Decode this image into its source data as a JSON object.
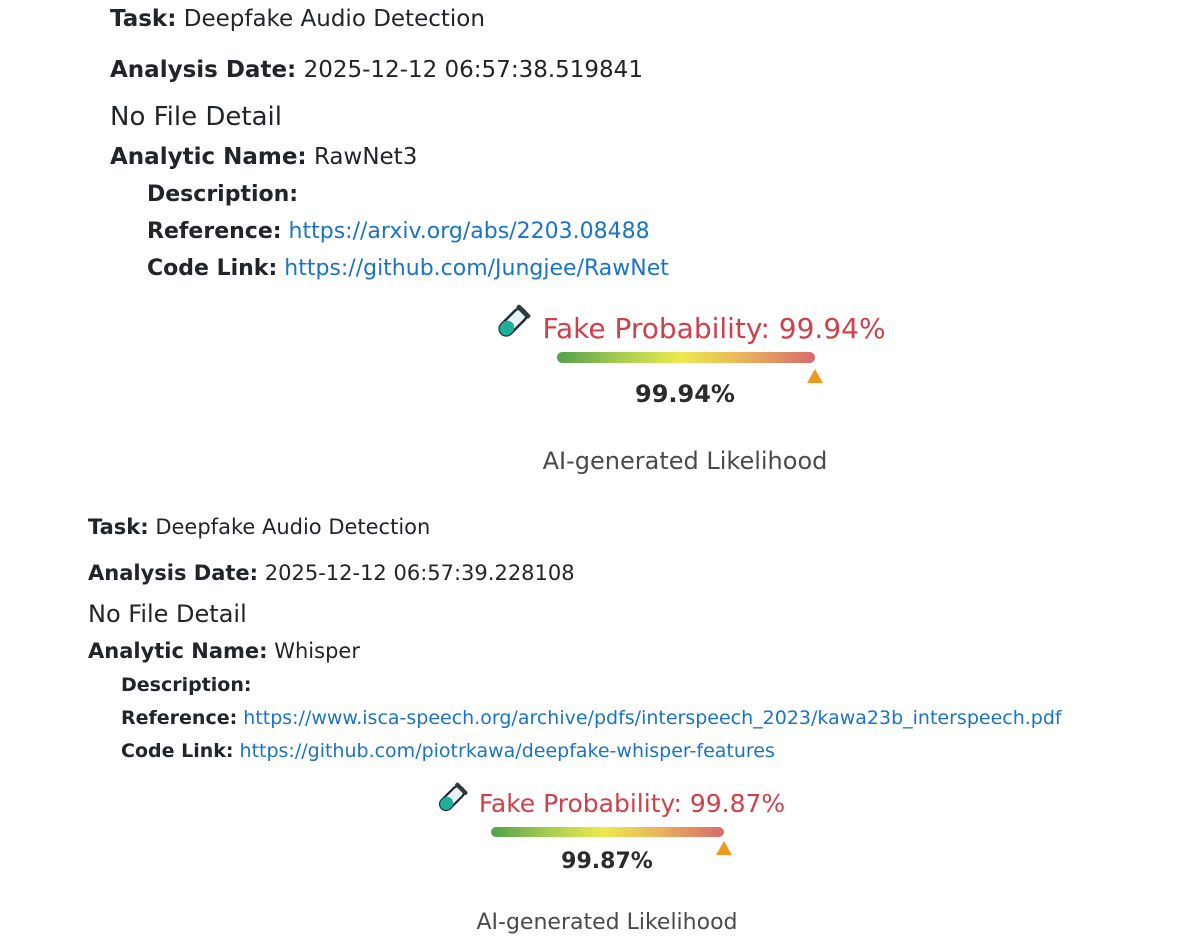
{
  "labels": {
    "task": "Task:",
    "analysis_date": "Analysis Date:",
    "analytic_name": "Analytic Name:",
    "description": "Description:",
    "reference": "Reference:",
    "code_link": "Code Link:"
  },
  "results": [
    {
      "task": "Deepfake Audio Detection",
      "analysis_date": "2025-12-12 06:57:38.519841",
      "file_detail": "No File Detail",
      "analytic_name": "RawNet3",
      "description": "",
      "reference": "https://arxiv.org/abs/2203.08488",
      "code_link": "https://github.com/Jungjee/RawNet",
      "fake_probability_text": "Fake Probability: 99.94%",
      "gauge_value_text": "99.94%",
      "gauge_value": 99.94,
      "likelihood_label": "AI-generated Likelihood"
    },
    {
      "task": "Deepfake Audio Detection",
      "analysis_date": "2025-12-12 06:57:39.228108",
      "file_detail": "No File Detail",
      "analytic_name": "Whisper",
      "description": "",
      "reference": "https://www.isca-speech.org/archive/pdfs/interspeech_2023/kawa23b_interspeech.pdf",
      "code_link": "https://github.com/piotrkawa/deepfake-whisper-features",
      "fake_probability_text": "Fake Probability: 99.87%",
      "gauge_value_text": "99.87%",
      "gauge_value": 99.87,
      "likelihood_label": "AI-generated Likelihood"
    }
  ],
  "colors": {
    "fake_probability": "#d13f49",
    "link": "#1a73c8",
    "marker": "#ee9a20"
  },
  "icons": {
    "probability": "test-tube-icon"
  }
}
